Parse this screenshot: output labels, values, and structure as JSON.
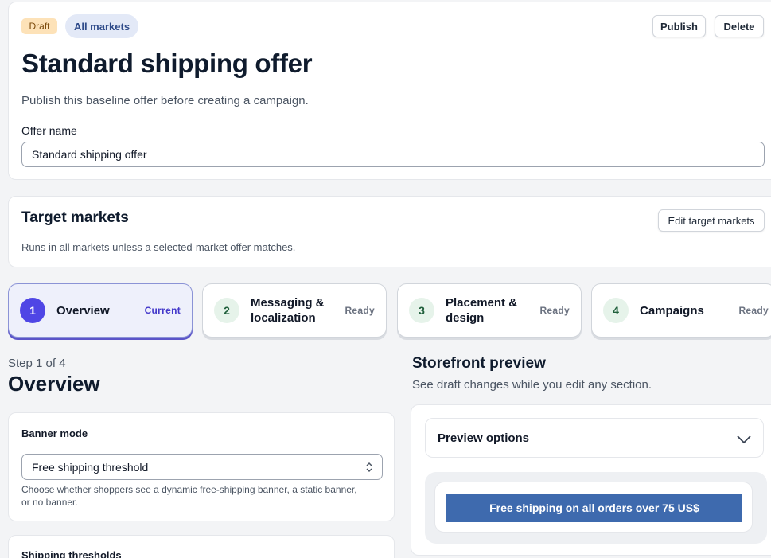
{
  "header": {
    "status_badge": "Draft",
    "scope_badge": "All markets",
    "publish_label": "Publish",
    "delete_label": "Delete",
    "title": "Standard shipping offer",
    "subtitle": "Publish this baseline offer before creating a campaign.",
    "offer_name_label": "Offer name",
    "offer_name_value": "Standard shipping offer"
  },
  "target_markets": {
    "title": "Target markets",
    "edit_label": "Edit target markets",
    "description": "Runs in all markets unless a selected-market offer matches."
  },
  "steps": [
    {
      "num": "1",
      "label": "Overview",
      "status": "Current"
    },
    {
      "num": "2",
      "label": "Messaging & localization",
      "status": "Ready"
    },
    {
      "num": "3",
      "label": "Placement & design",
      "status": "Ready"
    },
    {
      "num": "4",
      "label": "Campaigns",
      "status": "Ready"
    }
  ],
  "overview": {
    "step_counter": "Step 1 of 4",
    "title": "Overview",
    "banner_mode_label": "Banner mode",
    "banner_mode_value": "Free shipping threshold",
    "banner_mode_help": "Choose whether shoppers see a dynamic free-shipping banner, a static banner, or no banner.",
    "shipping_thresholds_label": "Shipping thresholds"
  },
  "preview": {
    "title": "Storefront preview",
    "subtitle": "See draft changes while you edit any section.",
    "options_label": "Preview options",
    "banner_text": "Free shipping on all orders over 75 US$"
  },
  "colors": {
    "accent": "#4f46e5",
    "banner": "#3e6aae",
    "draft_badge_bg": "#fde2b8",
    "markets_badge_bg": "#e3e9f7"
  },
  "icons": {
    "select": "chevron-up-down-icon",
    "options_toggle": "chevron-down-icon"
  }
}
